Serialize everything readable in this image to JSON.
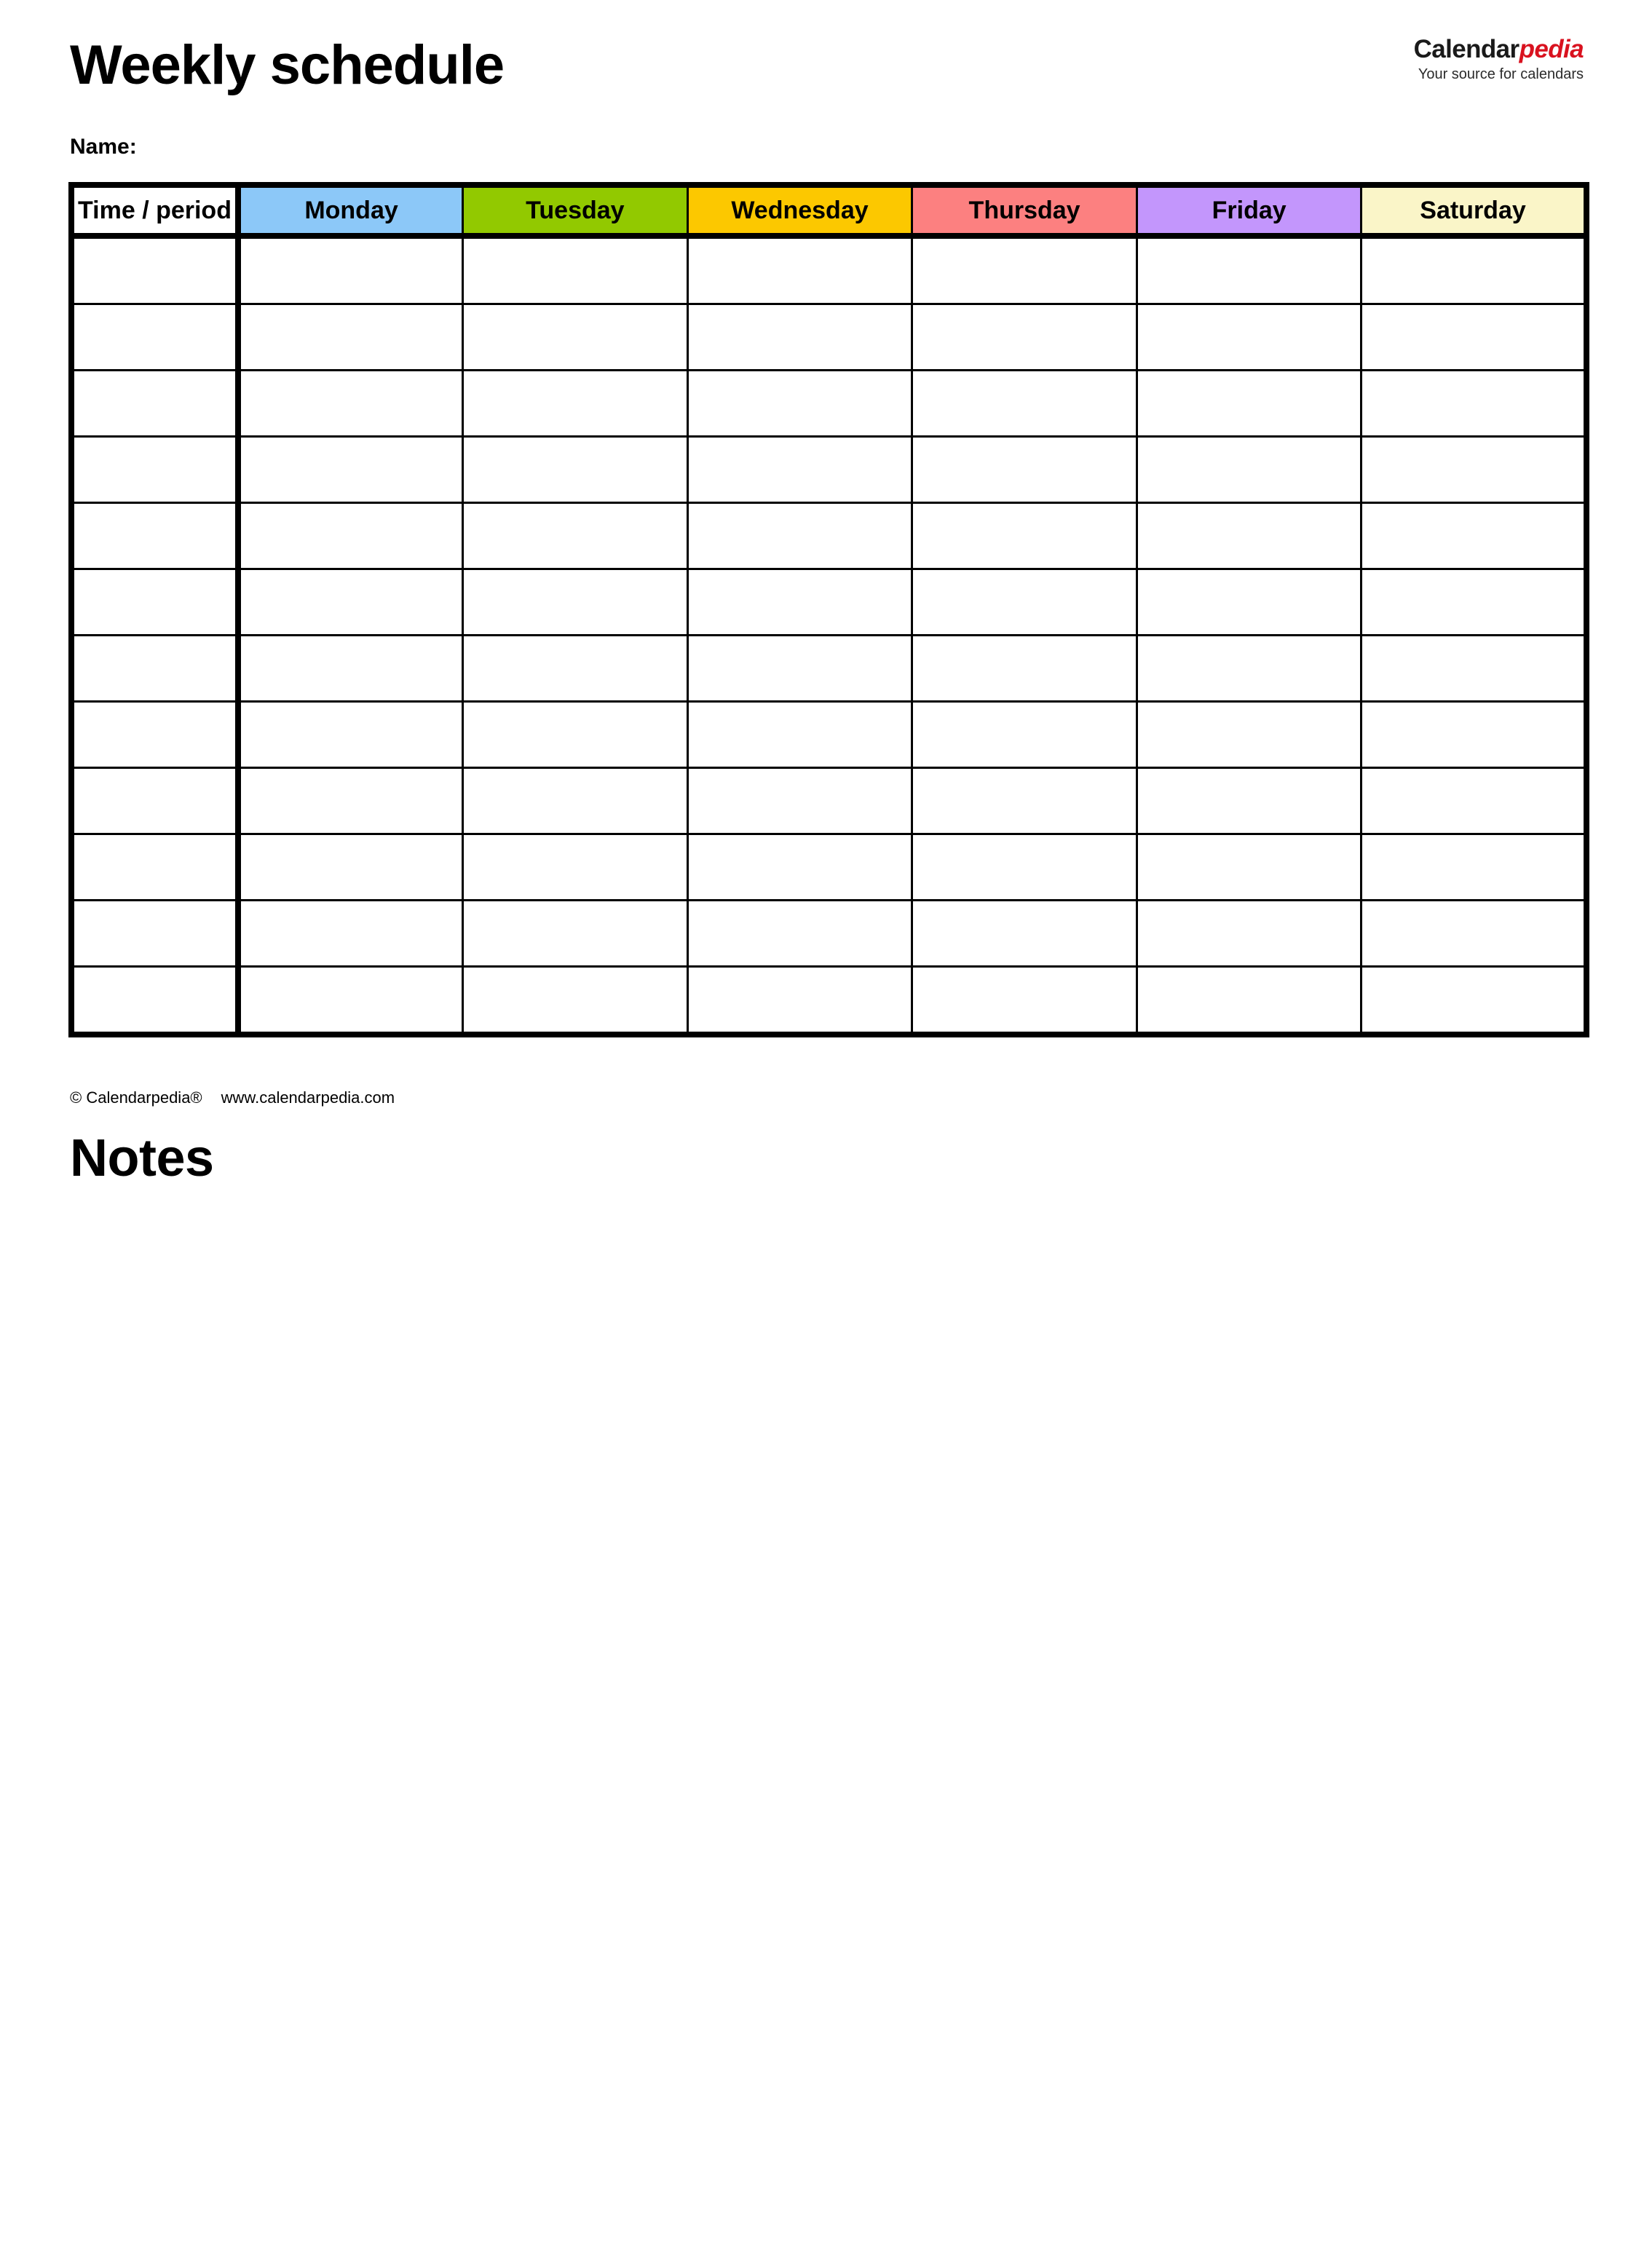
{
  "document": {
    "title": "Weekly schedule",
    "name_label": "Name:",
    "notes_heading": "Notes"
  },
  "brand": {
    "name_dark": "Calendar",
    "name_red": "pedia",
    "tagline": "Your source for calendars",
    "accent_color": "#d9121f",
    "dark_color": "#1a1a1a"
  },
  "schedule": {
    "columns": [
      {
        "label": "Time / period",
        "color": "#ffffff"
      },
      {
        "label": "Monday",
        "color": "#8cc8f8"
      },
      {
        "label": "Tuesday",
        "color": "#92c900"
      },
      {
        "label": "Wednesday",
        "color": "#fcc800"
      },
      {
        "label": "Thursday",
        "color": "#fc8080"
      },
      {
        "label": "Friday",
        "color": "#c396fc"
      },
      {
        "label": "Saturday",
        "color": "#faf5c8"
      }
    ],
    "row_count": 12,
    "rows": [
      {
        "time": "",
        "cells": [
          "",
          "",
          "",
          "",
          "",
          ""
        ]
      },
      {
        "time": "",
        "cells": [
          "",
          "",
          "",
          "",
          "",
          ""
        ]
      },
      {
        "time": "",
        "cells": [
          "",
          "",
          "",
          "",
          "",
          ""
        ]
      },
      {
        "time": "",
        "cells": [
          "",
          "",
          "",
          "",
          "",
          ""
        ]
      },
      {
        "time": "",
        "cells": [
          "",
          "",
          "",
          "",
          "",
          ""
        ]
      },
      {
        "time": "",
        "cells": [
          "",
          "",
          "",
          "",
          "",
          ""
        ]
      },
      {
        "time": "",
        "cells": [
          "",
          "",
          "",
          "",
          "",
          ""
        ]
      },
      {
        "time": "",
        "cells": [
          "",
          "",
          "",
          "",
          "",
          ""
        ]
      },
      {
        "time": "",
        "cells": [
          "",
          "",
          "",
          "",
          "",
          ""
        ]
      },
      {
        "time": "",
        "cells": [
          "",
          "",
          "",
          "",
          "",
          ""
        ]
      },
      {
        "time": "",
        "cells": [
          "",
          "",
          "",
          "",
          "",
          ""
        ]
      },
      {
        "time": "",
        "cells": [
          "",
          "",
          "",
          "",
          "",
          ""
        ]
      }
    ]
  },
  "credit": {
    "copyright": "© Calendarpedia®",
    "url": "www.calendarpedia.com"
  }
}
